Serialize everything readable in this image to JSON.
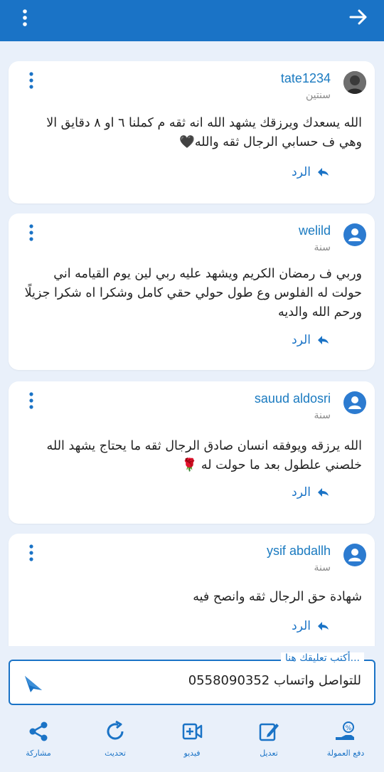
{
  "colors": {
    "primary": "#1a73c6",
    "background": "#e9f0fa"
  },
  "topbar": {
    "menu_icon": "kebab-vertical-icon",
    "back_icon": "arrow-right-icon"
  },
  "comments": [
    {
      "username": "tate1234",
      "time": "سنتين",
      "body": "الله يسعدك ويرزقك يشهد الله انه ثقه م كملنا ٦ او ٨ دقايق الا وهي ف حسابي الرجال ثقه والله🖤",
      "reply_label": "الرد",
      "avatar": "photo"
    },
    {
      "username": "welild",
      "time": "سنة",
      "body": "وربي ف رمضان الكريم ويشهد عليه ربي لين يوم القيامه اني حولت له الفلوس وع طول حولي حقي كامل وشكرا اه شكرا جزيلًا ورحم الله والديه",
      "reply_label": "الرد",
      "avatar": "default"
    },
    {
      "username": "sauud aldosri",
      "time": "سنة",
      "body": "الله يرزقه ويوفقه انسان صادق الرجال ثقه ما يحتاج  يشهد الله خلصني علطول بعد ما حولت له 🌹",
      "reply_label": "الرد",
      "avatar": "default"
    },
    {
      "username": "ysif abdallh",
      "time": "سنة",
      "body": "شهادة حق الرجال ثقه وانصح فيه",
      "reply_label": "الرد",
      "avatar": "default"
    }
  ],
  "composer": {
    "legend": "أكتب تعليقك هنا...",
    "value": "للتواصل واتساب 0558090352"
  },
  "bottom_bar": [
    {
      "label": "مشاركة",
      "icon": "share-icon"
    },
    {
      "label": "تحديث",
      "icon": "refresh-icon"
    },
    {
      "label": "فيديو",
      "icon": "video-add-icon"
    },
    {
      "label": "تعديل",
      "icon": "edit-icon"
    },
    {
      "label": "دفع العمولة",
      "icon": "commission-payment-icon"
    }
  ]
}
